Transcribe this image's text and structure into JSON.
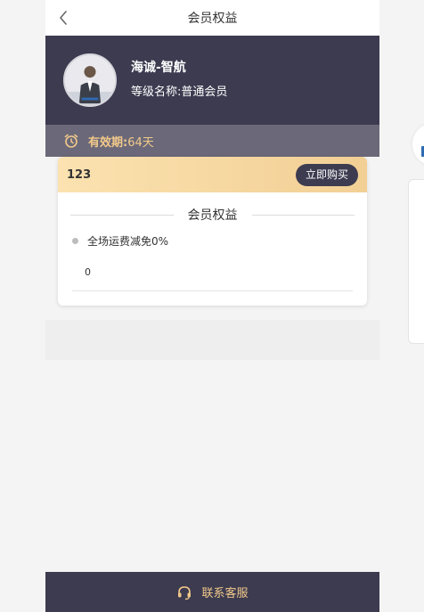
{
  "header": {
    "title": "会员权益"
  },
  "profile": {
    "name": "海诚-智航",
    "level": "等级名称:普通会员"
  },
  "validity": {
    "label": "有效期:",
    "value": "64天"
  },
  "card": {
    "name": "123",
    "buy_label": "立即购买",
    "section_title": "会员权益",
    "benefit": "全场运费减免0%",
    "benefit_value": "0"
  },
  "footer": {
    "contact_label": "联系客服"
  },
  "icons": {
    "back": "chevron-left-icon",
    "clock": "alarm-clock-icon",
    "headset": "headset-icon"
  },
  "colors": {
    "dark": "#3c3b50",
    "validity_bar": "#6b6979",
    "gold": "#f2c98a",
    "card_gradient_start": "#fbe2b0",
    "card_gradient_end": "#f2cf94",
    "background": "#f4f4f4"
  }
}
